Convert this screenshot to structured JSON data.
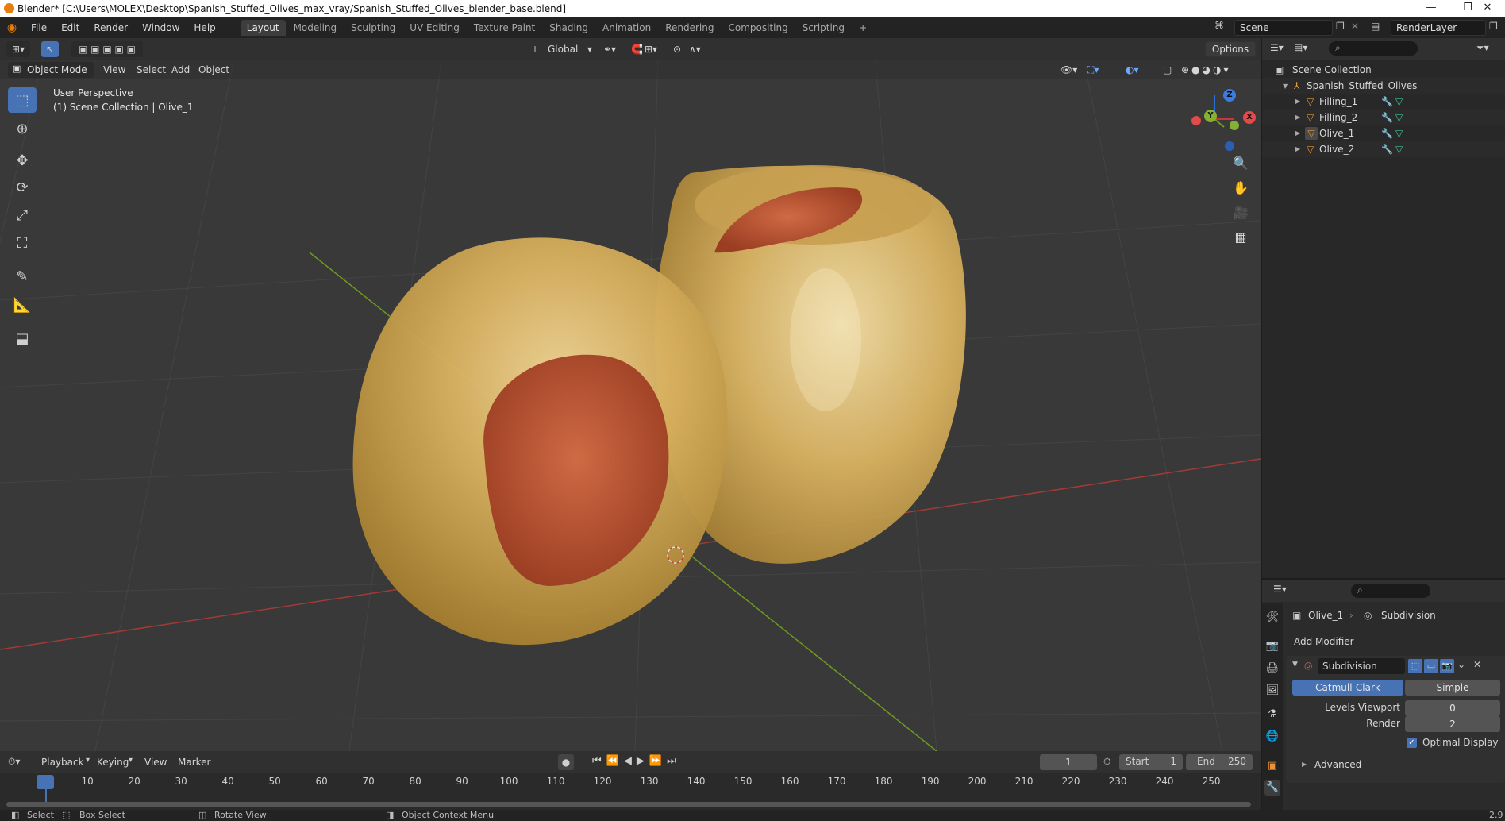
{
  "window": {
    "title": "Blender* [C:\\Users\\MOLEX\\Desktop\\Spanish_Stuffed_Olives_max_vray/Spanish_Stuffed_Olives_blender_base.blend]",
    "minimize": "—",
    "restore": "❐",
    "close": "✕"
  },
  "menu": {
    "items": [
      "File",
      "Edit",
      "Render",
      "Window",
      "Help"
    ]
  },
  "workspaces": {
    "tabs": [
      "Layout",
      "Modeling",
      "Sculpting",
      "UV Editing",
      "Texture Paint",
      "Shading",
      "Animation",
      "Rendering",
      "Compositing",
      "Scripting"
    ],
    "add": "+"
  },
  "scene": {
    "name": "Scene",
    "render_layer": "RenderLayer"
  },
  "viewport_header": {
    "transform_orientation": "Global",
    "options": "Options",
    "mode": "Object Mode",
    "menus": [
      "View",
      "Select",
      "Add",
      "Object"
    ]
  },
  "viewport": {
    "perspective_label": "User Perspective",
    "collection_label": "(1) Scene Collection | Olive_1",
    "gizmo": {
      "z": "Z",
      "y": "Y",
      "x": "X"
    }
  },
  "outliner": {
    "scene_collection": "Scene Collection",
    "collection": "Spanish_Stuffed_Olives",
    "objects": [
      "Filling_1",
      "Filling_2",
      "Olive_1",
      "Olive_2"
    ]
  },
  "properties": {
    "object": "Olive_1",
    "modifier_breadcrumb": "Subdivision",
    "add_modifier": "Add Modifier",
    "modifier": {
      "name": "Subdivision",
      "type_catmull": "Catmull-Clark",
      "type_simple": "Simple",
      "levels_viewport_label": "Levels Viewport",
      "levels_viewport_value": "0",
      "render_label": "Render",
      "render_value": "2",
      "optimal_display": "Optimal Display",
      "optimal_display_checked": true,
      "advanced": "Advanced"
    }
  },
  "timeline": {
    "menus": [
      "Playback",
      "Keying",
      "View",
      "Marker"
    ],
    "current_frame": "1",
    "start_label": "Start",
    "start": "1",
    "end_label": "End",
    "end": "250",
    "ticks": [
      "1",
      "10",
      "20",
      "30",
      "40",
      "50",
      "60",
      "70",
      "80",
      "90",
      "100",
      "110",
      "120",
      "130",
      "140",
      "150",
      "160",
      "170",
      "180",
      "190",
      "200",
      "210",
      "220",
      "230",
      "240",
      "250"
    ]
  },
  "status": {
    "select": "Select",
    "box_select": "Box Select",
    "rotate_view": "Rotate View",
    "context_menu": "Object Context Menu",
    "version": "2.9"
  },
  "colors": {
    "accent": "#4772b3",
    "olive": "#c9a24a",
    "pimento": "#b8482e",
    "axis_x": "#b5372f",
    "axis_y": "#6d9a1f"
  }
}
